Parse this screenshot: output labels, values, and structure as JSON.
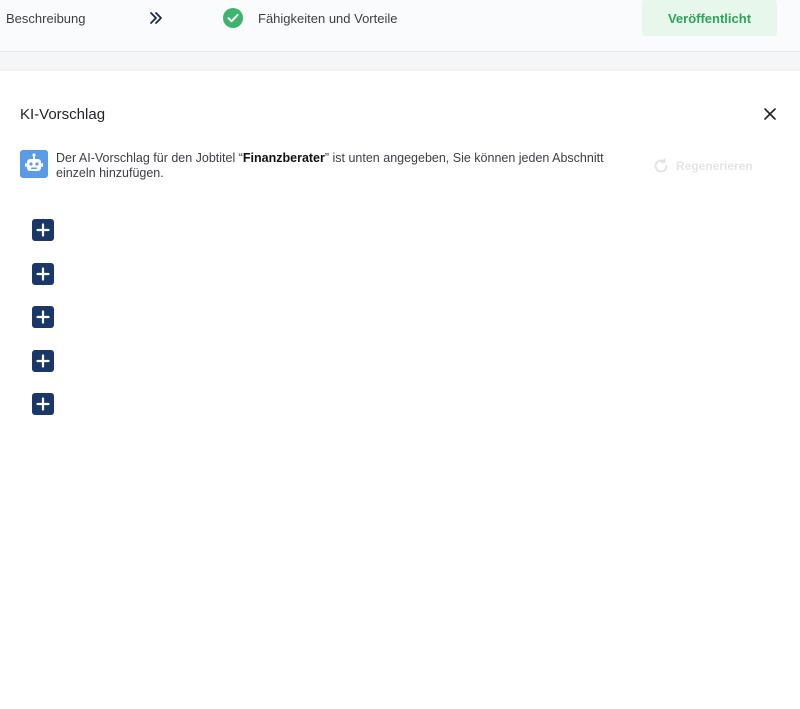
{
  "steps": {
    "description_label": "Beschreibung",
    "skills_label": "Fähigkeiten und Vorteile",
    "publish_label": "Veröffentlicht"
  },
  "panel": {
    "title": "KI-Vorschlag",
    "info_prefix": "Der AI-Vorschlag für den Jobtitel “",
    "job_title": "Finanzberater",
    "info_suffix": "” ist unten angegeben, Sie können jeden Abschnitt einzeln hinzufügen.",
    "regenerate_label": "Regenerieren"
  },
  "colors": {
    "accent_navy": "#1b3769",
    "success_green": "#2fa35a",
    "bot_blue": "#5a9be8"
  },
  "icons": [
    "double-chevron-right-icon",
    "check-circle-icon",
    "close-icon",
    "robot-icon",
    "refresh-icon",
    "plus-icon"
  ]
}
